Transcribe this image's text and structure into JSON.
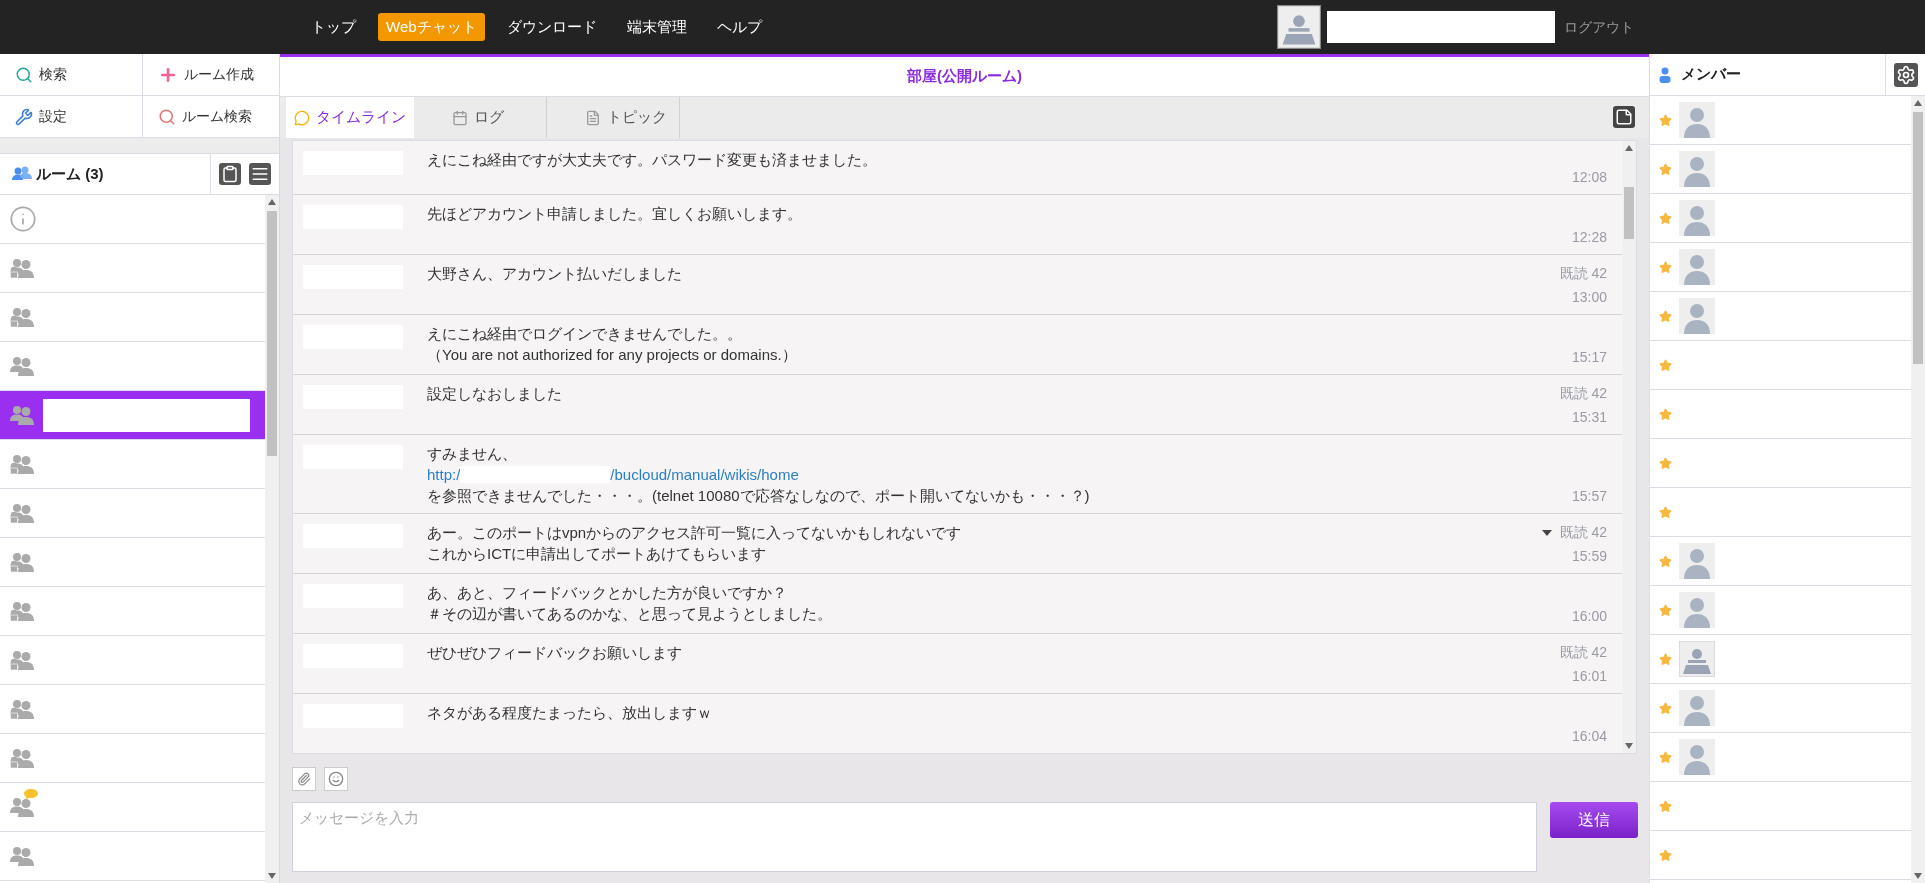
{
  "nav": {
    "items": [
      {
        "label": "トップ",
        "selected": false
      },
      {
        "label": "Webチャット",
        "selected": true
      },
      {
        "label": "ダウンロード",
        "selected": false
      },
      {
        "label": "端末管理",
        "selected": false
      },
      {
        "label": "ヘルプ",
        "selected": false
      }
    ],
    "logout": "ログアウト"
  },
  "left_menu": [
    {
      "label": "検索"
    },
    {
      "label": "ルーム作成"
    },
    {
      "label": "設定"
    },
    {
      "label": "ルーム検索"
    }
  ],
  "rooms": {
    "title": "ルーム (3)",
    "items": [
      {
        "kind": "info",
        "selected": false,
        "unread": false
      },
      {
        "kind": "locked",
        "selected": false,
        "unread": false
      },
      {
        "kind": "locked",
        "selected": false,
        "unread": false
      },
      {
        "kind": "group",
        "selected": false,
        "unread": false
      },
      {
        "kind": "group",
        "selected": true,
        "unread": false
      },
      {
        "kind": "locked",
        "selected": false,
        "unread": false
      },
      {
        "kind": "locked",
        "selected": false,
        "unread": false
      },
      {
        "kind": "locked",
        "selected": false,
        "unread": false
      },
      {
        "kind": "locked",
        "selected": false,
        "unread": false
      },
      {
        "kind": "locked",
        "selected": false,
        "unread": false
      },
      {
        "kind": "locked",
        "selected": false,
        "unread": false
      },
      {
        "kind": "locked",
        "selected": false,
        "unread": false
      },
      {
        "kind": "group",
        "selected": false,
        "unread": true
      },
      {
        "kind": "group",
        "selected": false,
        "unread": false
      }
    ]
  },
  "room": {
    "title": "部屋(公開ルーム)"
  },
  "tabs": [
    {
      "label": "タイムライン",
      "selected": true
    },
    {
      "label": "ログ",
      "selected": false
    },
    {
      "label": "トピック",
      "selected": false
    }
  ],
  "messages": [
    {
      "lines": [
        {
          "kind": "text",
          "text": "えにこね経由ですが大丈夫です。パスワード変更も済ませました。"
        }
      ],
      "time": "12:08",
      "menu": false
    },
    {
      "lines": [
        {
          "kind": "text",
          "text": "先ほどアカウント申請しました。宜しくお願いします。"
        }
      ],
      "time": "12:28",
      "menu": false
    },
    {
      "lines": [
        {
          "kind": "text",
          "text": "大野さん、アカウント払いだしました"
        }
      ],
      "read": "既読 42",
      "time": "13:00",
      "menu": false
    },
    {
      "lines": [
        {
          "kind": "text",
          "text": "えにこね経由でログインできませんでした。。"
        },
        {
          "kind": "text",
          "text": "（You are not authorized for any projects or domains.）"
        }
      ],
      "time": "15:17",
      "menu": false
    },
    {
      "lines": [
        {
          "kind": "text",
          "text": "設定しなおしました"
        }
      ],
      "read": "既読 42",
      "time": "15:31",
      "menu": false
    },
    {
      "lines": [
        {
          "kind": "text",
          "text": "すみません、"
        },
        {
          "kind": "link",
          "text": "http:/",
          "rest": "/bucloud/manual/wikis/home"
        },
        {
          "kind": "text",
          "text": "を参照できませんでした・・・。(telnet 10080で応答なしなので、ポート開いてないかも・・・？)"
        }
      ],
      "time": "15:57",
      "menu": false
    },
    {
      "lines": [
        {
          "kind": "text",
          "text": "あー。このポートはvpnからのアクセス許可一覧に入ってないかもしれないです"
        },
        {
          "kind": "text",
          "text": "これからICTに申請出してポートあけてもらいます"
        }
      ],
      "read": "既読 42",
      "time": "15:59",
      "menu": true
    },
    {
      "lines": [
        {
          "kind": "text",
          "text": "あ、あと、フィードバックとかした方が良いですか？"
        },
        {
          "kind": "text",
          "text": "＃その辺が書いてあるのかな、と思って見ようとしました。"
        }
      ],
      "time": "16:00",
      "menu": false
    },
    {
      "lines": [
        {
          "kind": "text",
          "text": "ぜひぜひフィードバックお願いします"
        }
      ],
      "read": "既読 42",
      "time": "16:01",
      "menu": false
    },
    {
      "lines": [
        {
          "kind": "text",
          "text": "ネタがある程度たまったら、放出しますｗ"
        }
      ],
      "time": "16:04",
      "menu": false
    }
  ],
  "composer": {
    "placeholder": "メッセージを入力",
    "send": "送信"
  },
  "members": {
    "title": "メンバー",
    "items": [
      {
        "favorite": true,
        "kind": "default"
      },
      {
        "favorite": true,
        "kind": "default"
      },
      {
        "favorite": true,
        "kind": "default"
      },
      {
        "favorite": true,
        "kind": "default"
      },
      {
        "favorite": true,
        "kind": "default"
      },
      {
        "favorite": true,
        "kind": "none"
      },
      {
        "favorite": true,
        "kind": "none"
      },
      {
        "favorite": true,
        "kind": "none"
      },
      {
        "favorite": true,
        "kind": "none"
      },
      {
        "favorite": true,
        "kind": "default"
      },
      {
        "favorite": true,
        "kind": "default"
      },
      {
        "favorite": true,
        "kind": "desk"
      },
      {
        "favorite": true,
        "kind": "default"
      },
      {
        "favorite": true,
        "kind": "default"
      },
      {
        "favorite": true,
        "kind": "none"
      },
      {
        "favorite": true,
        "kind": "none"
      }
    ]
  }
}
